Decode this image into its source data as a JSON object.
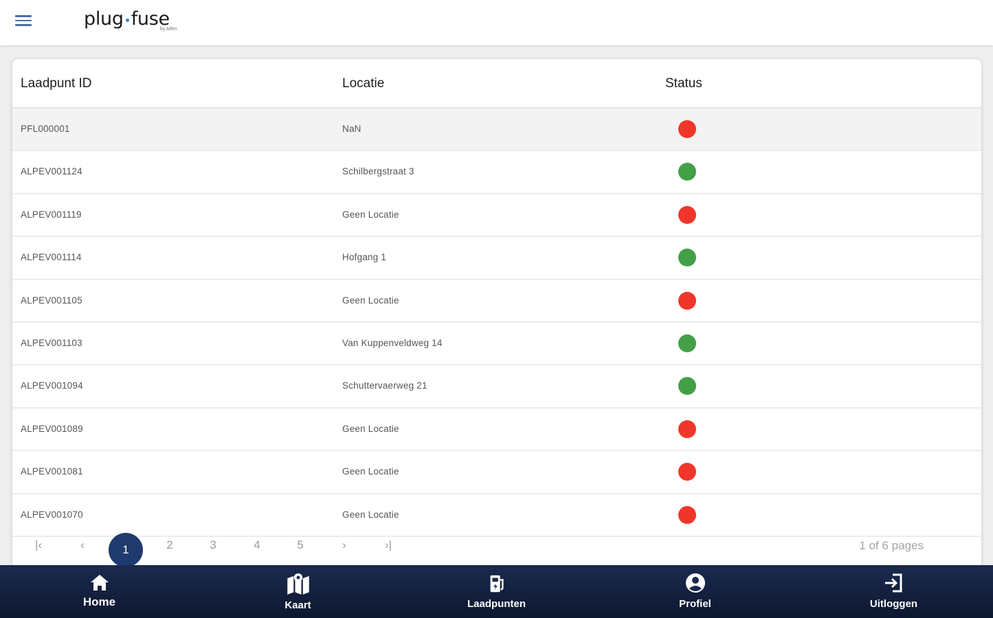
{
  "header": {
    "logo_left": "plug",
    "logo_right": "fuse",
    "logo_sub": "by Alfen"
  },
  "table": {
    "columns": [
      "Laadpunt ID",
      "Locatie",
      "Status"
    ],
    "rows": [
      {
        "id": "PFL000001",
        "location": "NaN",
        "status": "offline"
      },
      {
        "id": "ALPEV001124",
        "location": "Schilbergstraat 3",
        "status": "online"
      },
      {
        "id": "ALPEV001119",
        "location": "Geen Locatie",
        "status": "offline"
      },
      {
        "id": "ALPEV001114",
        "location": "Hofgang 1",
        "status": "online"
      },
      {
        "id": "ALPEV001105",
        "location": "Geen Locatie",
        "status": "offline"
      },
      {
        "id": "ALPEV001103",
        "location": "Van Kuppenveldweg 14",
        "status": "online"
      },
      {
        "id": "ALPEV001094",
        "location": "Schuttervaerweg 21",
        "status": "online"
      },
      {
        "id": "ALPEV001089",
        "location": "Geen Locatie",
        "status": "offline"
      },
      {
        "id": "ALPEV001081",
        "location": "Geen Locatie",
        "status": "offline"
      },
      {
        "id": "ALPEV001070",
        "location": "Geen Locatie",
        "status": "offline"
      }
    ]
  },
  "colors": {
    "online": "#43a047",
    "offline": "#f0362b",
    "nav_bg": "#1b2a4e",
    "active_page": "#1f3a6e"
  },
  "pagination": {
    "first": "|‹",
    "prev": "‹",
    "pages": [
      "1",
      "2",
      "3",
      "4",
      "5"
    ],
    "current": "1",
    "next": "›",
    "last": "›|",
    "info": "1 of 6 pages"
  },
  "nav": {
    "items": [
      {
        "label": "Home",
        "icon": "home-icon"
      },
      {
        "label": "Kaart",
        "icon": "map-icon"
      },
      {
        "label": "Laadpunten",
        "icon": "charger-icon"
      },
      {
        "label": "Profiel",
        "icon": "profile-icon"
      },
      {
        "label": "Uitloggen",
        "icon": "logout-icon"
      }
    ]
  }
}
